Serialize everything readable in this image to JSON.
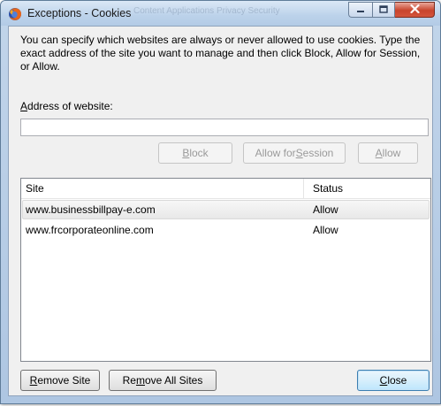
{
  "window": {
    "title": "Exceptions - Cookies",
    "background_tabs": "Content      Applications      Privacy      Security"
  },
  "dialog": {
    "intro_text": "You can specify which websites are always or never allowed to use cookies. Type the exact address of the site you want to manage and then click Block, Allow for Session, or Allow.",
    "address_label_mnemonic": "A",
    "address_label_rest": "ddress of website:",
    "address_value": "",
    "buttons": {
      "block": {
        "mnemonic": "B",
        "rest": "lock"
      },
      "allow_for_session": {
        "pre": "Allow for ",
        "mnemonic": "S",
        "rest": "ession"
      },
      "allow": {
        "mnemonic": "A",
        "rest": "llow"
      },
      "remove_site": {
        "pre": "",
        "mnemonic": "R",
        "rest": "emove Site"
      },
      "remove_all_sites": {
        "pre": "Re",
        "mnemonic": "m",
        "rest": "ove All Sites"
      },
      "close": {
        "mnemonic": "C",
        "rest": "lose"
      }
    },
    "sites_table": {
      "columns": [
        "Site",
        "Status"
      ],
      "rows": [
        {
          "site": "www.businessbillpay-e.com",
          "status": "Allow",
          "selected": true
        },
        {
          "site": "www.frcorporateonline.com",
          "status": "Allow",
          "selected": false
        }
      ]
    }
  },
  "colors": {
    "title_bar": "#bcd2ea",
    "dialog_bg": "#f0f0f0",
    "close_button": "#c8442c",
    "default_button_border": "#3c7fb1"
  },
  "icons": {
    "app": "firefox-icon",
    "minimize": "minimize-icon",
    "maximize": "maximize-icon",
    "close": "close-icon"
  }
}
